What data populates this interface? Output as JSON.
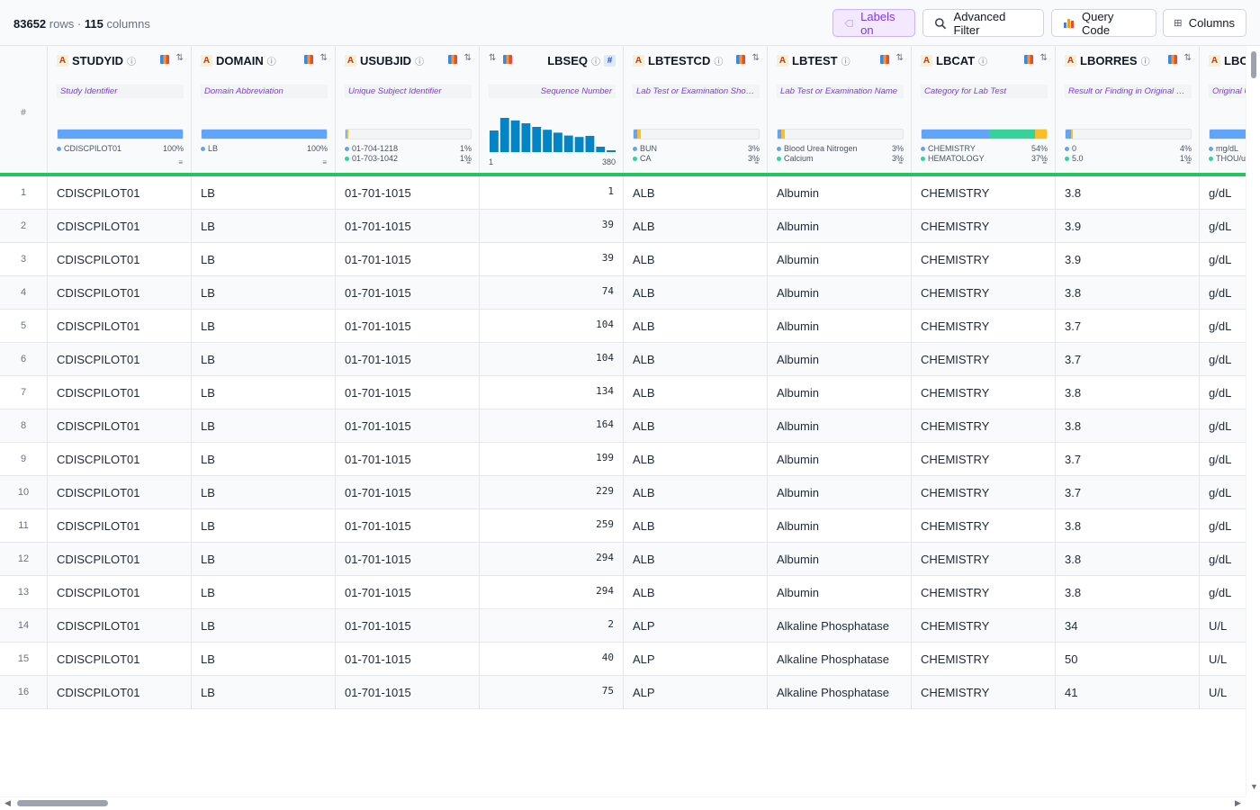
{
  "toolbar": {
    "row_count": "83652",
    "rows_word": "rows",
    "separator": "·",
    "col_count": "115",
    "cols_word": "columns",
    "labels_btn": "Labels on",
    "filter_btn": "Advanced Filter",
    "query_btn": "Query Code",
    "columns_btn": "Columns"
  },
  "index_header": "#",
  "colors": {
    "blue": "#60a5fa",
    "teal": "#34d399",
    "amber": "#fbbf24",
    "green": "#22c55e",
    "purple": "#7c3aed",
    "hist": "#0284c7"
  },
  "columns": [
    {
      "name": "STUDYID",
      "type": "A",
      "label": "Study Identifier",
      "segments": [
        {
          "color": "#60a5fa",
          "pct": 100
        }
      ],
      "legend": [
        {
          "text": "CDISCPILOT01",
          "pct": "100%",
          "color": "#60a5fa"
        }
      ]
    },
    {
      "name": "DOMAIN",
      "type": "A",
      "label": "Domain Abbreviation",
      "segments": [
        {
          "color": "#60a5fa",
          "pct": 100
        }
      ],
      "legend": [
        {
          "text": "LB",
          "pct": "100%",
          "color": "#60a5fa"
        }
      ]
    },
    {
      "name": "USUBJID",
      "type": "A",
      "label": "Unique Subject Identifier",
      "segments": [
        {
          "color": "#60a5fa",
          "pct": 1
        },
        {
          "color": "#fbbf24",
          "pct": 1
        }
      ],
      "legend": [
        {
          "text": "01-704-1218",
          "pct": "1%",
          "color": "#60a5fa"
        },
        {
          "text": "01-703-1042",
          "pct": "1%",
          "color": "#34d399"
        }
      ]
    },
    {
      "name": "LBSEQ",
      "type": "#",
      "label": "Sequence Number",
      "hist": [
        0.6,
        0.95,
        0.88,
        0.8,
        0.7,
        0.62,
        0.54,
        0.46,
        0.42,
        0.45,
        0.15,
        0.05
      ],
      "range_min": "1",
      "range_max": "380"
    },
    {
      "name": "LBTESTCD",
      "type": "A",
      "label": "Lab Test or Examination Short Name",
      "segments": [
        {
          "color": "#60a5fa",
          "pct": 3
        },
        {
          "color": "#fbbf24",
          "pct": 3
        }
      ],
      "legend": [
        {
          "text": "BUN",
          "pct": "3%",
          "color": "#60a5fa"
        },
        {
          "text": "CA",
          "pct": "3%",
          "color": "#34d399"
        }
      ]
    },
    {
      "name": "LBTEST",
      "type": "A",
      "label": "Lab Test or Examination Name",
      "segments": [
        {
          "color": "#60a5fa",
          "pct": 3
        },
        {
          "color": "#fbbf24",
          "pct": 3
        }
      ],
      "legend": [
        {
          "text": "Blood Urea Nitrogen",
          "pct": "3%",
          "color": "#60a5fa"
        },
        {
          "text": "Calcium",
          "pct": "3%",
          "color": "#34d399"
        }
      ]
    },
    {
      "name": "LBCAT",
      "type": "A",
      "label": "Category for Lab Test",
      "segments": [
        {
          "color": "#60a5fa",
          "pct": 54
        },
        {
          "color": "#34d399",
          "pct": 37
        },
        {
          "color": "#fbbf24",
          "pct": 9
        }
      ],
      "legend": [
        {
          "text": "CHEMISTRY",
          "pct": "54%",
          "color": "#60a5fa"
        },
        {
          "text": "HEMATOLOGY",
          "pct": "37%",
          "color": "#34d399"
        }
      ]
    },
    {
      "name": "LBORRES",
      "type": "A",
      "label": "Result or Finding in Original Units",
      "segments": [
        {
          "color": "#60a5fa",
          "pct": 4
        },
        {
          "color": "#fbbf24",
          "pct": 2
        }
      ],
      "legend": [
        {
          "text": "0",
          "pct": "4%",
          "color": "#60a5fa"
        },
        {
          "text": "5.0",
          "pct": "1%",
          "color": "#34d399"
        }
      ]
    },
    {
      "name": "LBORRESU",
      "type": "A",
      "label": "Original Units",
      "segments": [
        {
          "color": "#60a5fa",
          "pct": 70
        },
        {
          "color": "#34d399",
          "pct": 30
        }
      ],
      "legend": [
        {
          "text": "mg/dL",
          "pct": "",
          "color": "#60a5fa"
        },
        {
          "text": "THOU/uL",
          "pct": "",
          "color": "#34d399"
        }
      ]
    }
  ],
  "rows": [
    [
      "1",
      "CDISCPILOT01",
      "LB",
      "01-701-1015",
      "1",
      "ALB",
      "Albumin",
      "CHEMISTRY",
      "3.8",
      "g/dL"
    ],
    [
      "2",
      "CDISCPILOT01",
      "LB",
      "01-701-1015",
      "39",
      "ALB",
      "Albumin",
      "CHEMISTRY",
      "3.9",
      "g/dL"
    ],
    [
      "3",
      "CDISCPILOT01",
      "LB",
      "01-701-1015",
      "39",
      "ALB",
      "Albumin",
      "CHEMISTRY",
      "3.9",
      "g/dL"
    ],
    [
      "4",
      "CDISCPILOT01",
      "LB",
      "01-701-1015",
      "74",
      "ALB",
      "Albumin",
      "CHEMISTRY",
      "3.8",
      "g/dL"
    ],
    [
      "5",
      "CDISCPILOT01",
      "LB",
      "01-701-1015",
      "104",
      "ALB",
      "Albumin",
      "CHEMISTRY",
      "3.7",
      "g/dL"
    ],
    [
      "6",
      "CDISCPILOT01",
      "LB",
      "01-701-1015",
      "104",
      "ALB",
      "Albumin",
      "CHEMISTRY",
      "3.7",
      "g/dL"
    ],
    [
      "7",
      "CDISCPILOT01",
      "LB",
      "01-701-1015",
      "134",
      "ALB",
      "Albumin",
      "CHEMISTRY",
      "3.8",
      "g/dL"
    ],
    [
      "8",
      "CDISCPILOT01",
      "LB",
      "01-701-1015",
      "164",
      "ALB",
      "Albumin",
      "CHEMISTRY",
      "3.8",
      "g/dL"
    ],
    [
      "9",
      "CDISCPILOT01",
      "LB",
      "01-701-1015",
      "199",
      "ALB",
      "Albumin",
      "CHEMISTRY",
      "3.7",
      "g/dL"
    ],
    [
      "10",
      "CDISCPILOT01",
      "LB",
      "01-701-1015",
      "229",
      "ALB",
      "Albumin",
      "CHEMISTRY",
      "3.7",
      "g/dL"
    ],
    [
      "11",
      "CDISCPILOT01",
      "LB",
      "01-701-1015",
      "259",
      "ALB",
      "Albumin",
      "CHEMISTRY",
      "3.8",
      "g/dL"
    ],
    [
      "12",
      "CDISCPILOT01",
      "LB",
      "01-701-1015",
      "294",
      "ALB",
      "Albumin",
      "CHEMISTRY",
      "3.8",
      "g/dL"
    ],
    [
      "13",
      "CDISCPILOT01",
      "LB",
      "01-701-1015",
      "294",
      "ALB",
      "Albumin",
      "CHEMISTRY",
      "3.8",
      "g/dL"
    ],
    [
      "14",
      "CDISCPILOT01",
      "LB",
      "01-701-1015",
      "2",
      "ALP",
      "Alkaline Phosphatase",
      "CHEMISTRY",
      "34",
      "U/L"
    ],
    [
      "15",
      "CDISCPILOT01",
      "LB",
      "01-701-1015",
      "40",
      "ALP",
      "Alkaline Phosphatase",
      "CHEMISTRY",
      "50",
      "U/L"
    ],
    [
      "16",
      "CDISCPILOT01",
      "LB",
      "01-701-1015",
      "75",
      "ALP",
      "Alkaline Phosphatase",
      "CHEMISTRY",
      "41",
      "U/L"
    ]
  ]
}
